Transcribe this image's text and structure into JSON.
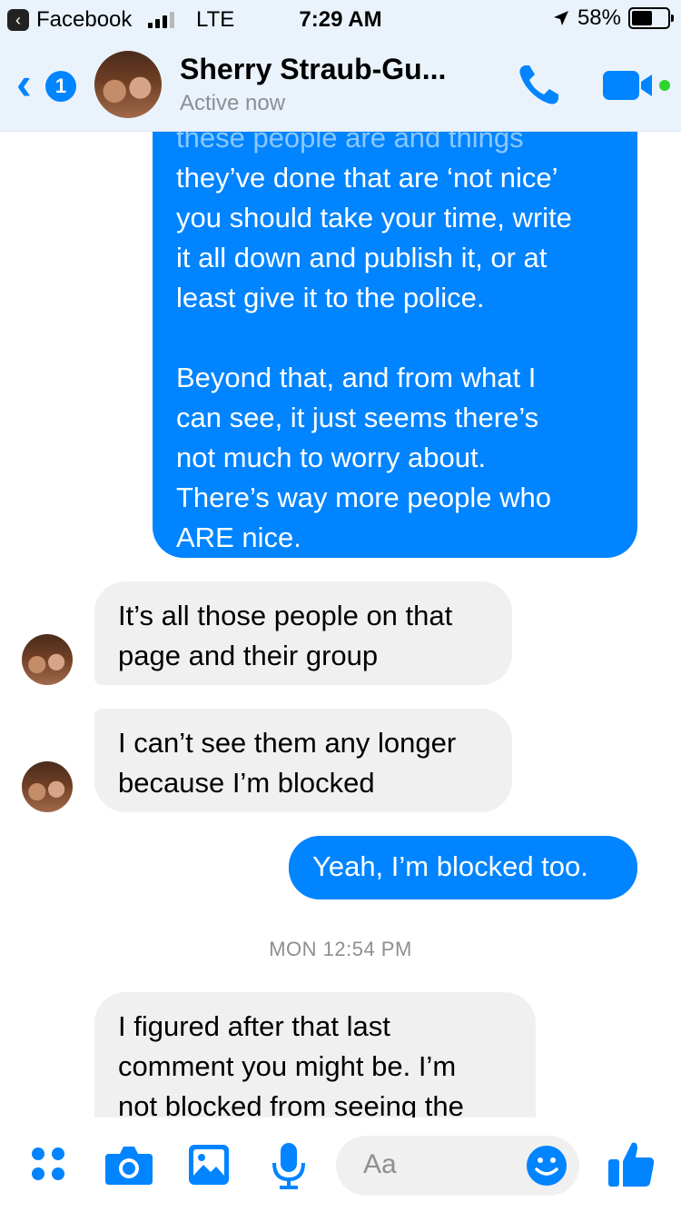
{
  "status_bar": {
    "back_app": "Facebook",
    "network": "LTE",
    "time": "7:29 AM",
    "battery": "58%"
  },
  "header": {
    "back_badge": "1",
    "contact_name": "Sherry Straub-Gu...",
    "status": "Active now"
  },
  "messages": [
    {
      "direction": "outgoing",
      "lines": [
        "these people are and things",
        "they’ve done that are ‘not nice’",
        "you should take your time, write",
        "it all down and publish it, or at",
        "least give it to the police.",
        "",
        "Beyond that, and from what I",
        "can see, it just seems there’s",
        "not much to worry about.",
        "There’s way more people who",
        "ARE nice."
      ]
    },
    {
      "direction": "incoming",
      "lines": [
        "It’s all those people on that",
        "page and their group"
      ]
    },
    {
      "direction": "incoming",
      "lines": [
        "I can’t see them any longer",
        "because I’m blocked"
      ]
    },
    {
      "direction": "outgoing",
      "lines": [
        "Yeah, I’m blocked too."
      ]
    },
    {
      "direction": "incoming",
      "lines": [
        "I figured after that last",
        "comment you might be. I’m",
        "not blocked from seeing the"
      ]
    }
  ],
  "timestamp": "MON 12:54 PM",
  "composer": {
    "placeholder": "Aa",
    "icons": [
      "more-icon",
      "camera-icon",
      "photo-icon",
      "microphone-icon",
      "emoji-icon",
      "thumbs-up-icon"
    ]
  },
  "colors": {
    "accent": "#0084ff",
    "header_bg": "#eaf3fb",
    "incoming_bubble": "#f0f0f0",
    "active_dot": "#2bd52b"
  }
}
